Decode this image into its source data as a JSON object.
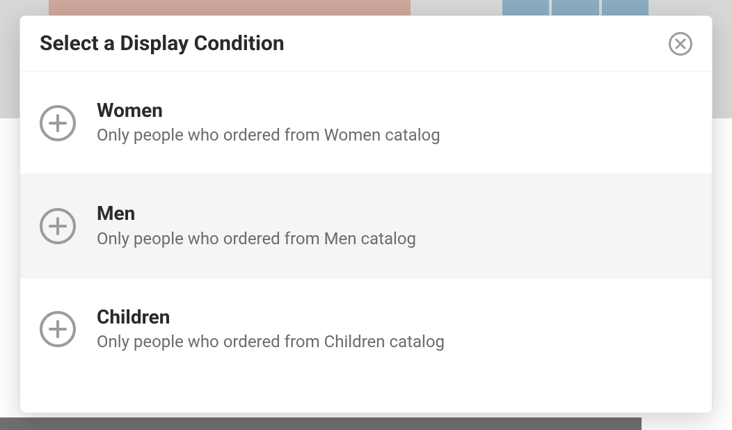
{
  "modal": {
    "title": "Select a Display Condition",
    "conditions": [
      {
        "title": "Women",
        "description": "Only people who ordered from Women catalog",
        "hovered": false
      },
      {
        "title": "Men",
        "description": "Only people who ordered from Men catalog",
        "hovered": true
      },
      {
        "title": "Children",
        "description": "Only people who ordered from Children catalog",
        "hovered": false
      }
    ]
  }
}
